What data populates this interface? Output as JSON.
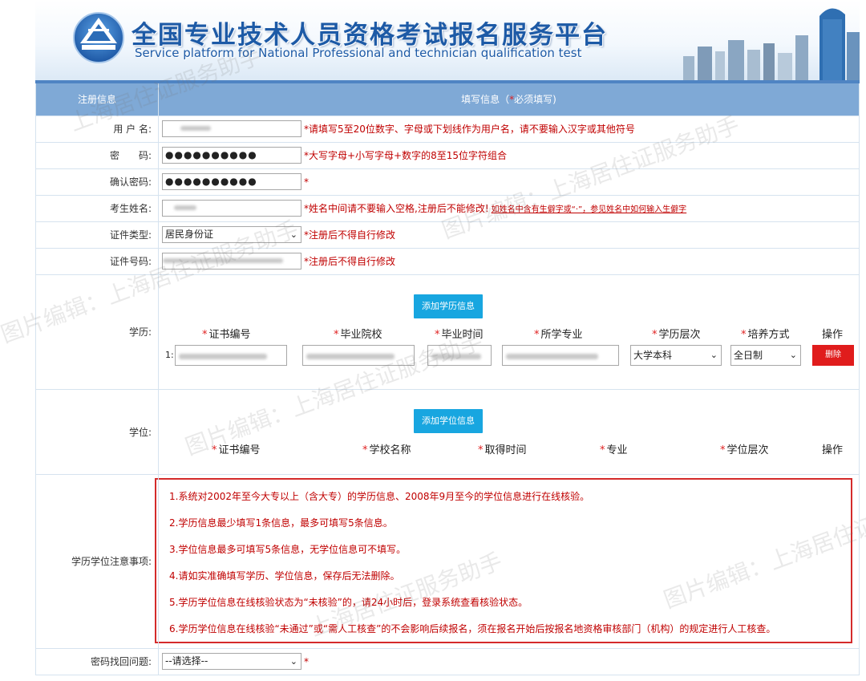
{
  "header": {
    "title": "全国专业技术人员资格考试报名服务平台",
    "subtitle": "Service platform for National Professional and technician qualification test"
  },
  "table_header": {
    "left": "注册信息",
    "right_prefix": "填写信息（",
    "right_star": "*",
    "right_suffix": "必须填写)"
  },
  "fields": {
    "username": {
      "label": "用 户 名:",
      "hint": "*请填写5至20位数字、字母或下划线作为用户名，请不要输入汉字或其他符号"
    },
    "password": {
      "label": "密　　码:",
      "value": "●●●●●●●●●●",
      "hint": "*大写字母+小写字母+数字的8至15位字符组合"
    },
    "confirm": {
      "label": "确认密码:",
      "value": "●●●●●●●●●●",
      "hint": "*"
    },
    "name": {
      "label": "考生姓名:",
      "hint": "*姓名中间请不要输入空格,注册后不能修改!",
      "link": "如姓名中含有生僻字或“·”，参见姓名中如何输入生僻字"
    },
    "id_type": {
      "label": "证件类型:",
      "value": "居民身份证",
      "hint": "*注册后不得自行修改"
    },
    "id_number": {
      "label": "证件号码:",
      "hint": "*注册后不得自行修改"
    }
  },
  "education": {
    "label": "学历:",
    "add_button": "添加学历信息",
    "columns": [
      "证书编号",
      "毕业院校",
      "毕业时间",
      "所学专业",
      "学历层次",
      "培养方式"
    ],
    "action_col": "操作",
    "row_index": "1:",
    "level_value": "大学本科",
    "mode_value": "全日制",
    "delete_button": "删除"
  },
  "degree": {
    "label": "学位:",
    "add_button": "添加学位信息",
    "columns": [
      "证书编号",
      "学校名称",
      "取得时间",
      "专业",
      "学位层次"
    ],
    "action_col": "操作"
  },
  "notes": {
    "label": "学历学位注意事项:",
    "items": [
      "1.系统对2002年至今大专以上（含大专）的学历信息、2008年9月至今的学位信息进行在线核验。",
      "2.学历信息最少填写1条信息，最多可填写5条信息。",
      "3.学位信息最多可填写5条信息，无学位信息可不填写。",
      "4.请如实准确填写学历、学位信息，保存后无法删除。",
      "5.学历学位信息在线核验状态为“未核验”的，请24小时后，登录系统查看核验状态。",
      "6.学历学位信息在线核验“未通过”或“需人工核查”的不会影响后续报名，须在报名开始后按报名地资格审核部门（机构）的规定进行人工核查。"
    ]
  },
  "recovery": {
    "label": "密码找回问题:",
    "value": "--请选择--",
    "hint": "*"
  },
  "watermarks": {
    "a": "图片编辑：上海居住证服务助手",
    "b": "上海居住证服务助手",
    "c": "图片编辑：上海居住证"
  }
}
